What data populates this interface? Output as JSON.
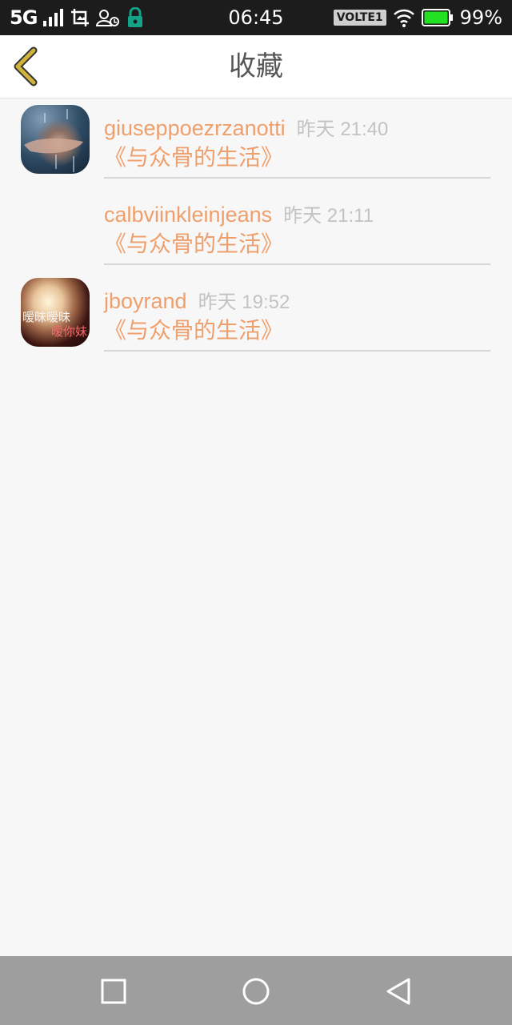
{
  "status_bar": {
    "network": "5G",
    "time": "06:45",
    "volte": "VOLTE1",
    "battery": "99%",
    "icons": [
      "signal-icon",
      "screenshot-icon",
      "user-key-icon",
      "lock-icon",
      "wifi-icon",
      "battery-icon"
    ],
    "battery_color": "#22e022"
  },
  "header": {
    "title": "收藏",
    "back_icon": "chevron-left-icon",
    "back_color": "#d1b23a"
  },
  "favorites": [
    {
      "username": "giuseppoezrzanotti",
      "time": "昨天 21:40",
      "book": "《与众骨的生活》",
      "avatar": "rain-hand-avatar"
    },
    {
      "username": "calbviinkleinjeans",
      "time": "昨天 21:11",
      "book": "《与众骨的生活》",
      "avatar": ""
    },
    {
      "username": "jboyrand",
      "time": "昨天 19:52",
      "book": "《与众骨的生活》",
      "avatar": "girl-text-avatar",
      "avatar_text_1": "暧昧暧昧",
      "avatar_text_2": "暧你妹"
    }
  ],
  "colors": {
    "accent": "#ef9f6c",
    "time_text": "#c3c3c3",
    "divider": "#d6d6d6",
    "nav_bar": "#9e9e9e"
  },
  "nav_bar": {
    "buttons": [
      "recent-apps-icon",
      "home-icon",
      "back-icon"
    ]
  }
}
